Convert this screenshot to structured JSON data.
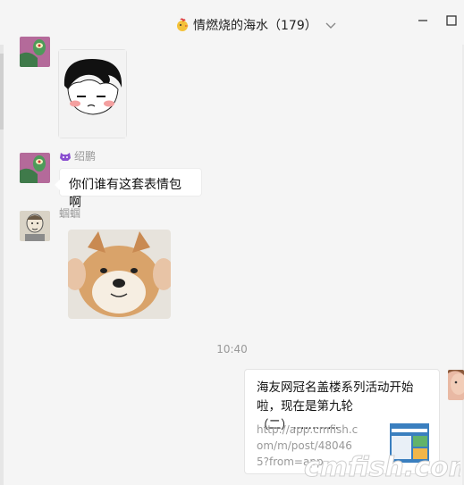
{
  "header": {
    "title": "情燃烧的海水（179）"
  },
  "messages": [
    {
      "sender": "",
      "type": "sticker"
    },
    {
      "sender": "绍鹏",
      "text": "你们谁有这套表情包啊"
    },
    {
      "sender": "蝈蝈",
      "type": "image"
    }
  ],
  "timestamp": "10:40",
  "link_card": {
    "title": "海友网冠名盖楼系列活动开始啦，现在是第九轮（二）............",
    "url": "http://app.cmfish.com/m/post/480465?from=app"
  },
  "watermark": "cmfish.com"
}
